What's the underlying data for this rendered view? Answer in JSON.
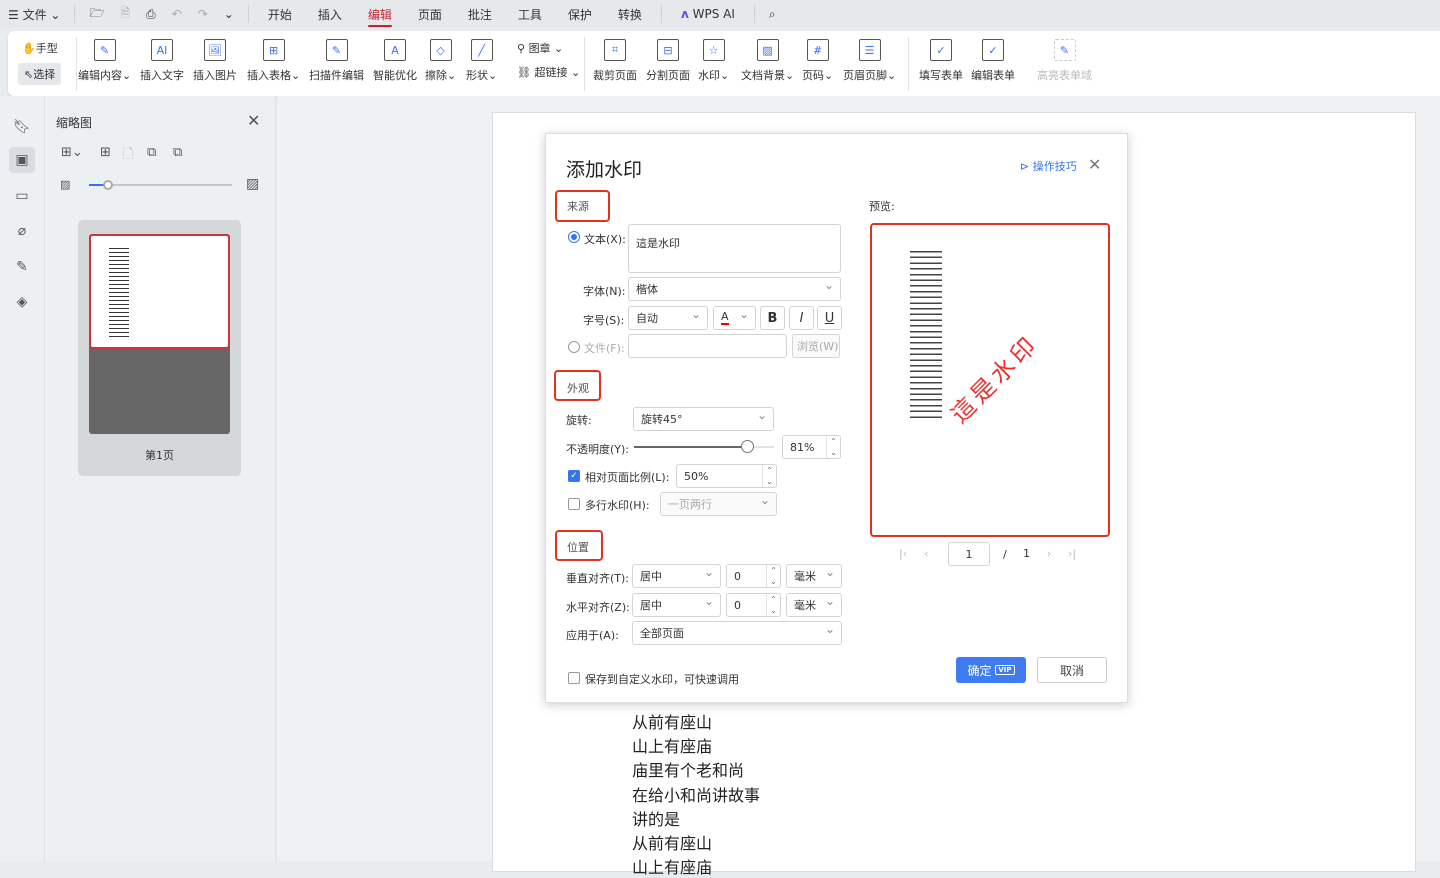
{
  "topbar": {
    "menu": "文件",
    "tabs": [
      "开始",
      "插入",
      "编辑",
      "页面",
      "批注",
      "工具",
      "保护",
      "转换"
    ],
    "active_tab": "编辑",
    "wps_ai": "WPS AI"
  },
  "ribbon": {
    "hand": "手型",
    "select": "选择",
    "items": [
      "编辑内容",
      "插入文字",
      "插入图片",
      "插入表格",
      "扫描件编辑",
      "智能优化",
      "擦除",
      "形状",
      "图章",
      "超链接",
      "裁剪页面",
      "分割页面",
      "水印",
      "文档背景",
      "页码",
      "页眉页脚",
      "填写表单",
      "编辑表单",
      "高亮表单域"
    ]
  },
  "thumbs": {
    "title": "缩略图",
    "page_label": "第1页",
    "zoom_fraction": 0.13
  },
  "document": {
    "lines": [
      "从前有座山",
      "山上有座庙",
      "庙里有个老和尚",
      "在给小和尚讲故事",
      "讲的是",
      "从前有座山",
      "山上有座庙"
    ]
  },
  "dialog": {
    "title": "添加水印",
    "tips": "操作技巧",
    "source_label": "来源",
    "text_label": "文本(X):",
    "text_value": "這是水印",
    "font_label": "字体(N):",
    "font_value": "楷体",
    "size_label": "字号(S):",
    "size_value": "自动",
    "color_glyph": "A",
    "bold": "B",
    "italic": "I",
    "underline": "U",
    "file_label": "文件(F):",
    "browse": "浏览(W)",
    "appearance_label": "外观",
    "rotate_label": "旋转:",
    "rotate_value": "旋转45°",
    "opacity_label": "不透明度(Y):",
    "opacity_value": "81%",
    "opacity_fraction": 0.81,
    "scale_label": "相对页面比例(L):",
    "scale_value": "50%",
    "multiline_label": "多行水印(H):",
    "multiline_value": "一页两行",
    "position_label": "位置",
    "valign_label": "垂直对齐(T):",
    "valign_value": "居中",
    "valign_offset": "0",
    "valign_unit": "毫米",
    "halign_label": "水平对齐(Z):",
    "halign_value": "居中",
    "halign_offset": "0",
    "halign_unit": "毫米",
    "apply_label": "应用于(A):",
    "apply_value": "全部页面",
    "save_custom": "保存到自定义水印，可快速调用",
    "preview_label": "预览:",
    "preview_watermark": "這是水印",
    "page_current": "1",
    "page_sep": "/",
    "page_total": "1",
    "ok": "确定",
    "vip": "VIP",
    "cancel": "取消"
  },
  "colors": {
    "accent": "#3575f0",
    "highlight": "#e0321e",
    "watermark": "#f03030",
    "active_tab": "#c8202d"
  }
}
